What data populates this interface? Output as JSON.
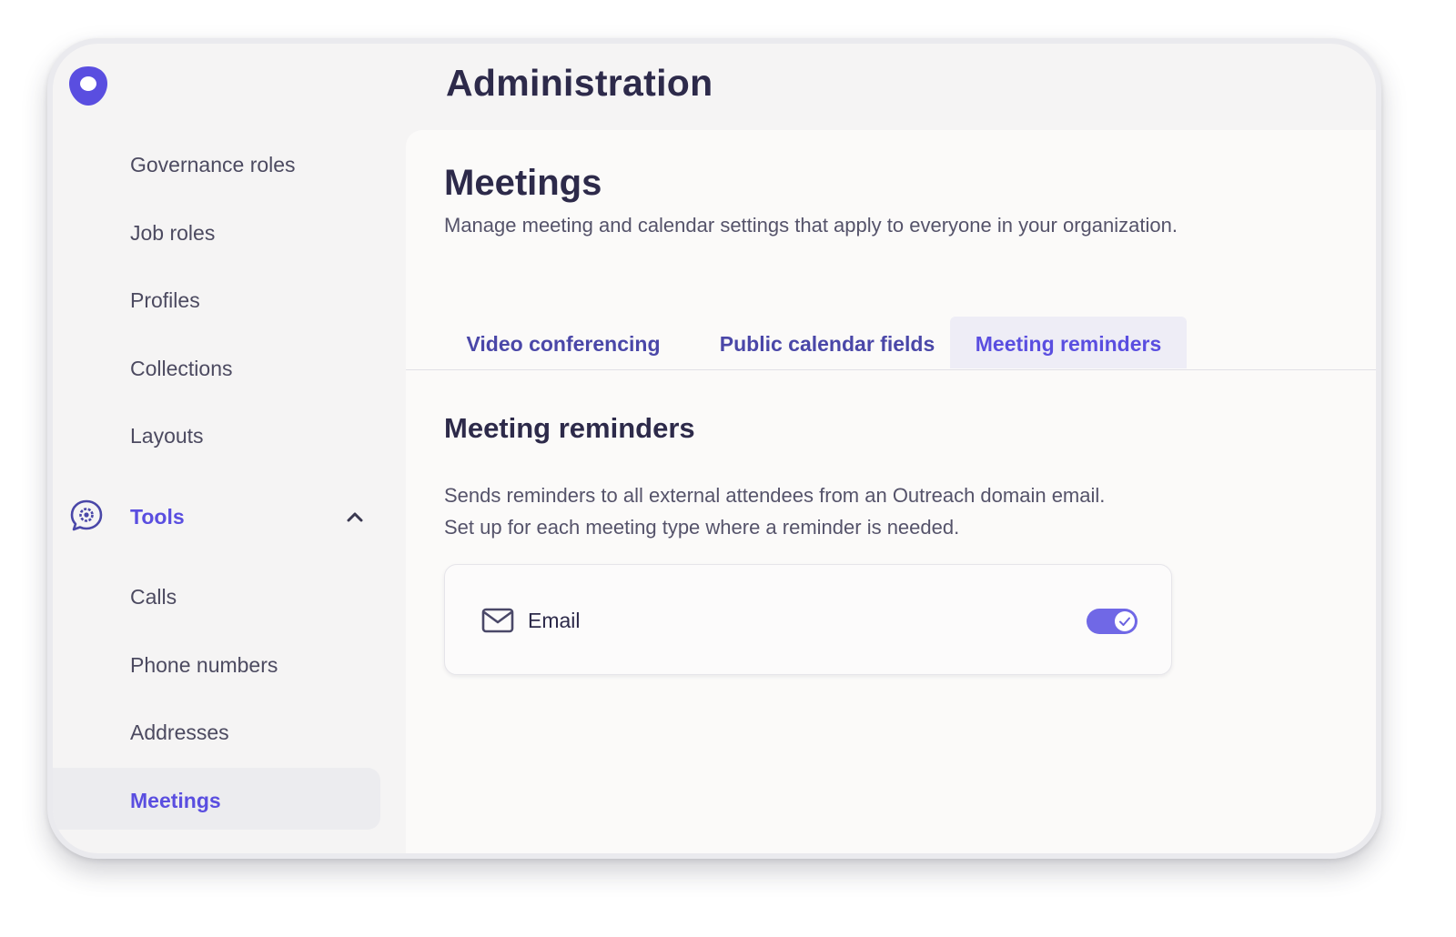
{
  "app": {
    "title": "Administration",
    "logo_icon": "outreach-logo-icon",
    "brand_color": "#5a4ee0"
  },
  "sidebar": {
    "items": [
      {
        "label": "Governance roles"
      },
      {
        "label": "Job roles"
      },
      {
        "label": "Profiles"
      },
      {
        "label": "Collections"
      },
      {
        "label": "Layouts"
      }
    ],
    "tools": {
      "label": "Tools",
      "icon": "gear-chat-icon",
      "expanded": true,
      "chevron_icon": "chevron-up-icon",
      "items": [
        {
          "label": "Calls"
        },
        {
          "label": "Phone numbers"
        },
        {
          "label": "Addresses"
        },
        {
          "label": "Meetings",
          "active": true
        }
      ]
    }
  },
  "main": {
    "title": "Meetings",
    "subtitle": "Manage meeting and calendar settings that apply to everyone in your organization.",
    "tabs": [
      {
        "label": "Video conferencing",
        "selected": false
      },
      {
        "label": "Public calendar fields",
        "selected": false
      },
      {
        "label": "Meeting reminders",
        "selected": true
      }
    ],
    "section": {
      "title": "Meeting reminders",
      "description_line1": "Sends reminders to all external attendees from an Outreach domain email.",
      "description_line2": "Set up for each meeting type where a reminder is needed.",
      "card": {
        "icon": "mail-icon",
        "label": "Email",
        "toggle_on": true
      }
    }
  }
}
